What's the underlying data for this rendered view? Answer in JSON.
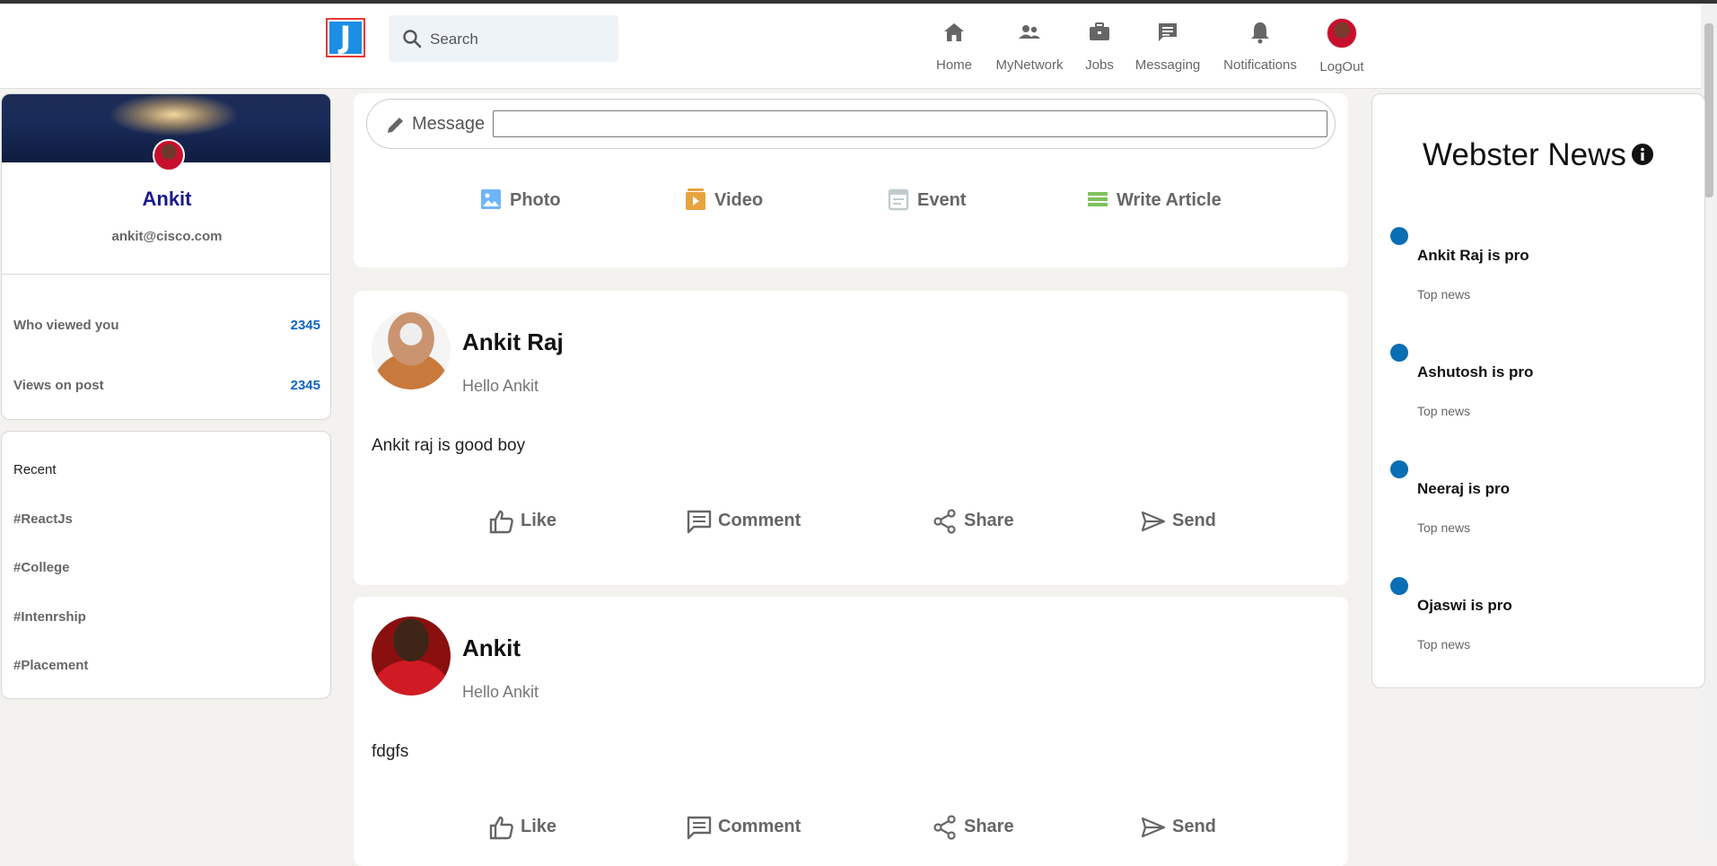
{
  "header": {
    "logo_letter": "J",
    "search_placeholder": "Search",
    "nav": [
      {
        "label": "Home",
        "icon": "home-icon"
      },
      {
        "label": "MyNetwork",
        "icon": "people-icon"
      },
      {
        "label": "Jobs",
        "icon": "briefcase-icon"
      },
      {
        "label": "Messaging",
        "icon": "chat-icon"
      },
      {
        "label": "Notifications",
        "icon": "bell-icon"
      },
      {
        "label": "LogOut",
        "icon": "avatar"
      }
    ]
  },
  "profile": {
    "name": "Ankit",
    "email": "ankit@cisco.com",
    "stats": [
      {
        "label": "Who viewed you",
        "value": "2345"
      },
      {
        "label": "Views on post",
        "value": "2345"
      }
    ]
  },
  "recent": {
    "title": "Recent",
    "tags": [
      "#ReactJs",
      "#College",
      "#Intenrship",
      "#Placement"
    ]
  },
  "composer": {
    "message_label": "Message",
    "options": [
      {
        "label": "Photo",
        "icon": "photo-icon",
        "color": "#70b5f9"
      },
      {
        "label": "Video",
        "icon": "video-icon",
        "color": "#e7a33e"
      },
      {
        "label": "Event",
        "icon": "calendar-icon",
        "color": "#c0cbcd"
      },
      {
        "label": "Write Article",
        "icon": "article-icon",
        "color": "#7fc15e"
      }
    ]
  },
  "posts": [
    {
      "name": "Ankit Raj",
      "subtitle": "Hello Ankit",
      "text": "Ankit raj is good boy"
    },
    {
      "name": "Ankit",
      "subtitle": "Hello Ankit",
      "text": "fdgfs"
    }
  ],
  "post_actions": [
    "Like",
    "Comment",
    "Share",
    "Send"
  ],
  "news": {
    "title": "Webster News",
    "items": [
      {
        "headline": "Ankit Raj is pro",
        "sub": "Top news"
      },
      {
        "headline": "Ashutosh is pro",
        "sub": "Top news"
      },
      {
        "headline": "Neeraj is pro",
        "sub": "Top news"
      },
      {
        "headline": "Ojaswi is pro",
        "sub": "Top news"
      }
    ]
  }
}
